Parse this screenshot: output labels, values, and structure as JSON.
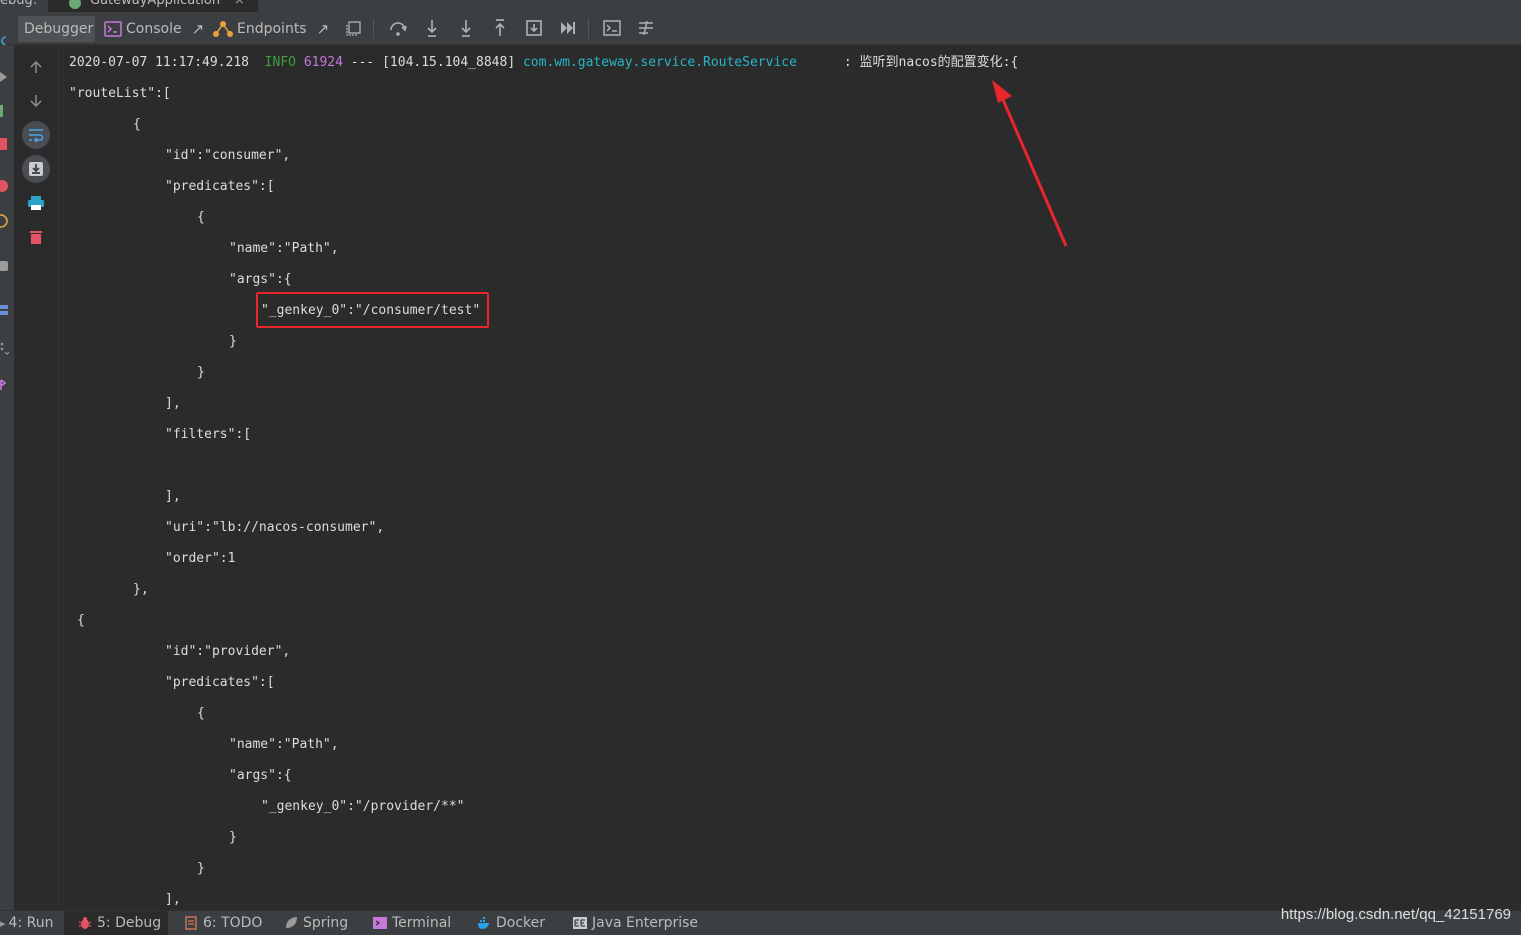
{
  "header": {
    "debug_label": "ebug:",
    "session_tab": "GatewayApplication",
    "session_close": "×"
  },
  "toolbar": {
    "debugger_label": "Debugger",
    "console_label": "Console",
    "console_pin": "↗",
    "endpoints_label": "Endpoints",
    "endpoints_pin": "↗",
    "icons": [
      "restore-layout-icon",
      "step-over-icon",
      "step-into-icon",
      "force-step-into-icon",
      "step-out-icon",
      "run-to-cursor-icon",
      "resume-icon",
      "evaluate-icon",
      "trace-icon"
    ]
  },
  "log": {
    "timestamp": "2020-07-07 11:17:49.218",
    "level": "INFO",
    "pid": "61924",
    "separator": "---",
    "thread": "[104.15.104_8848]",
    "logger": "com.wm.gateway.service.RouteService",
    "message": ": 监听到nacos的配置变化:{"
  },
  "console_lines": [
    "\"routeList\":[",
    "{",
    "\"id\":\"consumer\",",
    "\"predicates\":[",
    "{",
    "\"name\":\"Path\",",
    "\"args\":{",
    "\"_genkey_0\":\"/consumer/test\"",
    "}",
    "}",
    "],",
    "\"filters\":[",
    "],",
    "\"uri\":\"lb://nacos-consumer\",",
    "\"order\":1",
    "},",
    "{",
    "\"id\":\"provider\",",
    "\"predicates\":[",
    "{",
    "\"name\":\"Path\",",
    "\"args\":{",
    "\"_genkey_0\":\"/provider/**\"",
    "}",
    "}",
    "],"
  ],
  "bottom_bar": {
    "run": "4: Run",
    "debug": "5: Debug",
    "todo": "6: TODO",
    "spring": "Spring",
    "terminal": "Terminal",
    "docker": "Docker",
    "java_enterprise": "Java Enterprise"
  },
  "watermark": "https://blog.csdn.net/qq_42151769",
  "colors": {
    "background": "#2b2b2b",
    "toolbar": "#3c3f41",
    "info_level": "#3e9e3e",
    "pid": "#c678dd",
    "logger": "#28b5c7",
    "annotation_red": "#e8262b"
  }
}
